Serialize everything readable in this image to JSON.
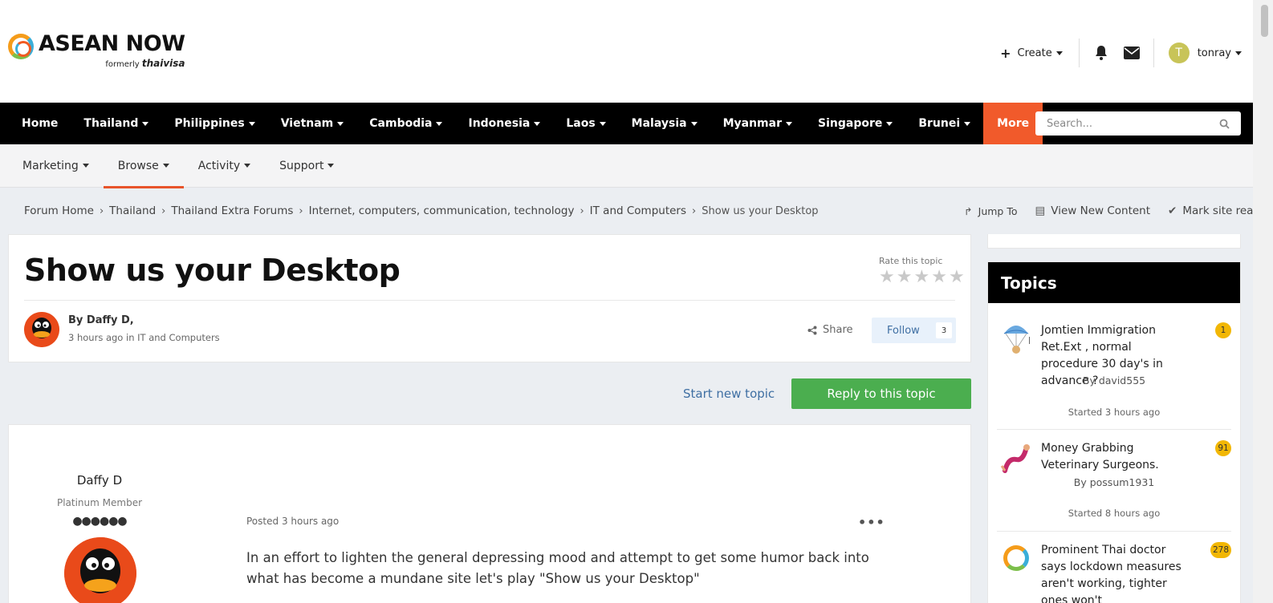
{
  "brand": {
    "name": "ASEAN NOW",
    "formerly": "formerly",
    "old_name": "thaivisa"
  },
  "user_bar": {
    "create_label": "Create",
    "username": "tonray",
    "avatar_letter": "T"
  },
  "nav": {
    "items": [
      "Home",
      "Thailand",
      "Philippines",
      "Vietnam",
      "Cambodia",
      "Indonesia",
      "Laos",
      "Malaysia",
      "Myanmar",
      "Singapore",
      "Brunei"
    ],
    "more": "More"
  },
  "search": {
    "placeholder": "Search..."
  },
  "subnav": {
    "items": [
      "Marketing",
      "Browse",
      "Activity",
      "Support"
    ],
    "active": "Browse"
  },
  "breadcrumb": [
    "Forum Home",
    "Thailand",
    "Thailand Extra Forums",
    "Internet, computers, communication, technology",
    "IT and Computers",
    "Show us your Desktop"
  ],
  "crumb_actions": {
    "jump_to": "Jump To",
    "view_new": "View New Content",
    "mark_read": "Mark site read"
  },
  "topic": {
    "title": "Show us your Desktop",
    "rate_label": "Rate this topic",
    "rating": 0,
    "by": "By Daffy D,",
    "meta_time": "3 hours ago",
    "meta_in": "in",
    "meta_forum": "IT and Computers",
    "share": "Share",
    "follow": "Follow",
    "follow_count": "3"
  },
  "actions": {
    "start_new": "Start new topic",
    "reply": "Reply to this topic"
  },
  "post": {
    "author": "Daffy D",
    "rank": "Platinum Member",
    "pips": "●●●●●●",
    "posted_label": "Posted",
    "posted_time": "3 hours ago",
    "menu": "•••",
    "body": "In an effort to lighten the general depressing mood and attempt to get some humor back into what has become a mundane site let's play  \"Show us your Desktop\""
  },
  "sidebar": {
    "heading": "Topics",
    "items": [
      {
        "title": "Jomtien Immigration Ret.Ext , normal procedure 30 day's in advance ?",
        "by": "By david555",
        "started": "Started 3 hours ago",
        "count": "1"
      },
      {
        "title": "Money Grabbing Veterinary Surgeons.",
        "by": "By possum1931",
        "started": "Started 8 hours ago",
        "count": "91"
      },
      {
        "title": "Prominent Thai doctor says lockdown measures aren't working, tighter ones won't",
        "count": "278"
      }
    ]
  },
  "colors": {
    "accent": "#f15a2b",
    "reply_green": "#4bae4f",
    "badge": "#f2b705",
    "link": "#3f6fa3"
  }
}
